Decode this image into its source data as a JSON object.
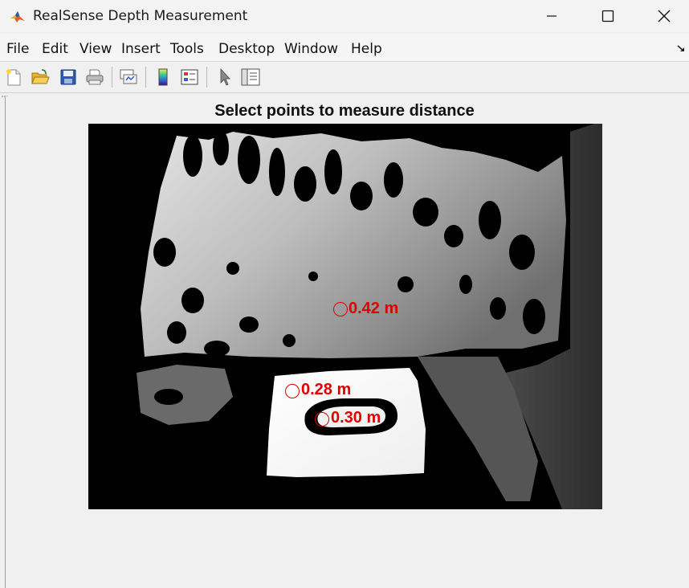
{
  "window": {
    "title": "RealSense Depth Measurement",
    "icon": "matlab-logo-icon",
    "controls": [
      "minimize-icon",
      "maximize-icon",
      "close-icon"
    ]
  },
  "menu": {
    "items": [
      "File",
      "Edit",
      "View",
      "Insert",
      "Tools",
      "Desktop",
      "Window",
      "Help"
    ]
  },
  "toolbar": {
    "buttons": [
      "new-figure-icon",
      "open-icon",
      "save-icon",
      "print-icon",
      "link-plot-icon",
      "colorbar-icon",
      "legend-icon",
      "edit-plot-arrow-icon",
      "property-inspector-icon"
    ]
  },
  "axes": {
    "title": "Select points to measure distance"
  },
  "measurements": [
    {
      "label": "0.42 m",
      "color": "#e00000"
    },
    {
      "label": "0.28 m",
      "color": "#e00000"
    },
    {
      "label": "0.30 m",
      "color": "#e00000"
    }
  ]
}
